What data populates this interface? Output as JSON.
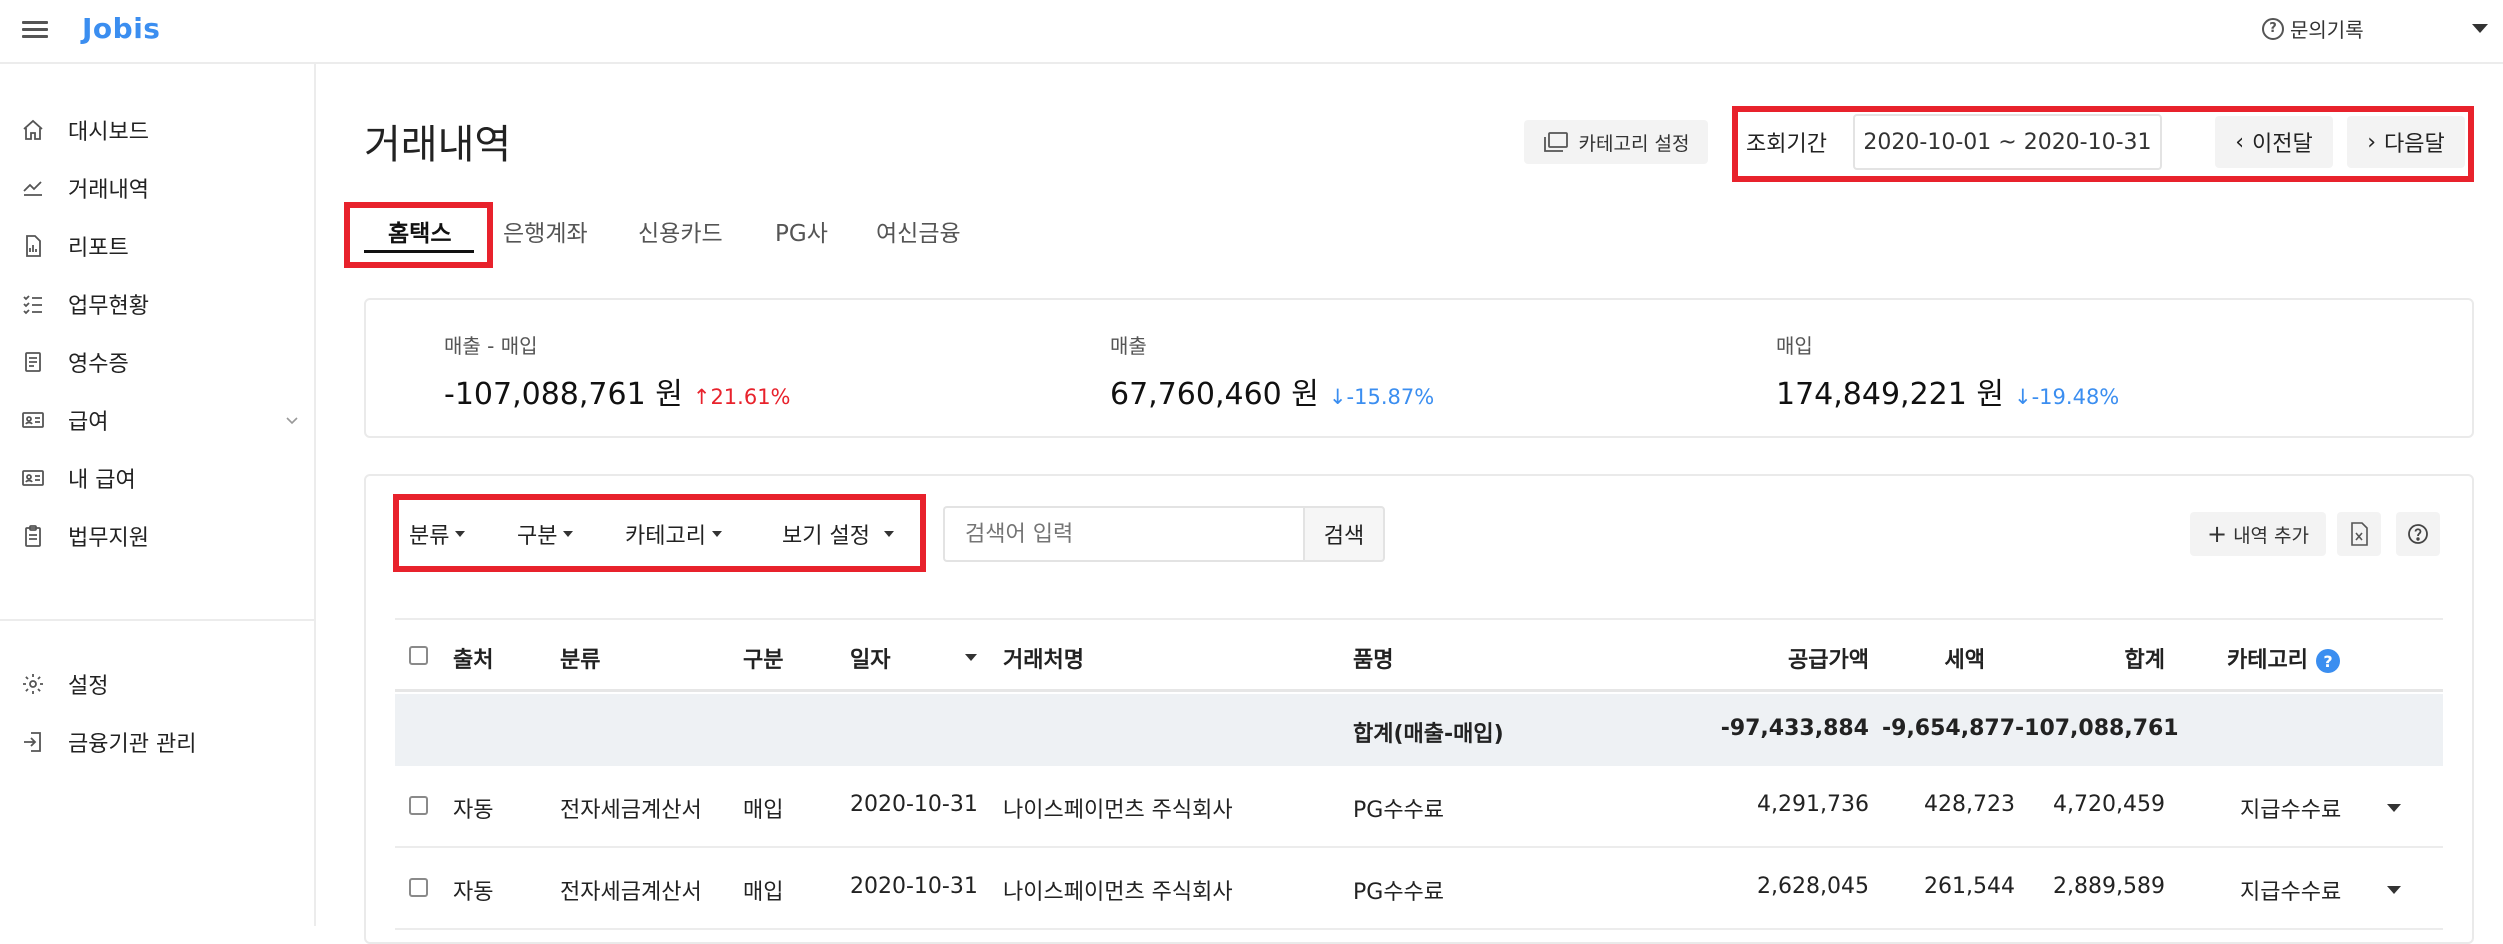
{
  "header": {
    "logo": "Jobis",
    "inquiry_label": "문의기록"
  },
  "sidebar": {
    "items": [
      {
        "label": "대시보드",
        "icon": "home-icon"
      },
      {
        "label": "거래내역",
        "icon": "trend-icon"
      },
      {
        "label": "리포트",
        "icon": "report-icon"
      },
      {
        "label": "업무현황",
        "icon": "checklist-icon"
      },
      {
        "label": "영수증",
        "icon": "receipt-icon"
      },
      {
        "label": "급여",
        "icon": "id-card-icon"
      },
      {
        "label": "내 급여",
        "icon": "id-card-icon"
      },
      {
        "label": "법무지원",
        "icon": "clipboard-icon"
      },
      {
        "label": "설정",
        "icon": "gear-icon"
      },
      {
        "label": "금융기관 관리",
        "icon": "login-icon"
      }
    ]
  },
  "page": {
    "title": "거래내역",
    "category_settings": "카테고리 설정",
    "period_label": "조회기간",
    "period_value": "2020-10-01 ~ 2020-10-31",
    "prev_month": "이전달",
    "next_month": "다음달"
  },
  "tabs": [
    "홈택스",
    "은행계좌",
    "신용카드",
    "PG사",
    "여신금융"
  ],
  "summary": [
    {
      "label": "매출 - 매입",
      "value": "-107,088,761 원",
      "delta": "21.61%",
      "direction": "up",
      "arrow": "↑"
    },
    {
      "label": "매출",
      "value": "67,760,460 원",
      "delta": "-15.87%",
      "direction": "down",
      "arrow": "↓"
    },
    {
      "label": "매입",
      "value": "174,849,221 원",
      "delta": "-19.48%",
      "direction": "down",
      "arrow": "↓"
    }
  ],
  "filters": {
    "classification": "분류",
    "division": "구분",
    "category": "카테고리",
    "view_settings": "보기 설정",
    "search_placeholder": "검색어 입력",
    "search_button": "검색",
    "add_entry": "내역 추가"
  },
  "table": {
    "headers": {
      "source": "출처",
      "classification": "분류",
      "division": "구분",
      "date": "일자",
      "vendor": "거래처명",
      "item": "품명",
      "supply": "공급가액",
      "tax": "세액",
      "total": "합계",
      "category": "카테고리"
    },
    "total_row": {
      "label": "합계(매출-매입)",
      "supply": "-97,433,884",
      "tax": "-9,654,877",
      "total": "-107,088,761"
    },
    "rows": [
      {
        "source": "자동",
        "classification": "전자세금계산서",
        "division": "매입",
        "date": "2020-10-31",
        "vendor": "나이스페이먼츠 주식회사",
        "item": "PG수수료",
        "supply": "4,291,736",
        "tax": "428,723",
        "total": "4,720,459",
        "category": "지급수수료"
      },
      {
        "source": "자동",
        "classification": "전자세금계산서",
        "division": "매입",
        "date": "2020-10-31",
        "vendor": "나이스페이먼츠 주식회사",
        "item": "PG수수료",
        "supply": "2,628,045",
        "tax": "261,544",
        "total": "2,889,589",
        "category": "지급수수료"
      }
    ]
  },
  "colors": {
    "brand": "#3b8ef0",
    "highlight": "#e8222c",
    "up": "#e8222c",
    "down": "#3b8ef0"
  }
}
